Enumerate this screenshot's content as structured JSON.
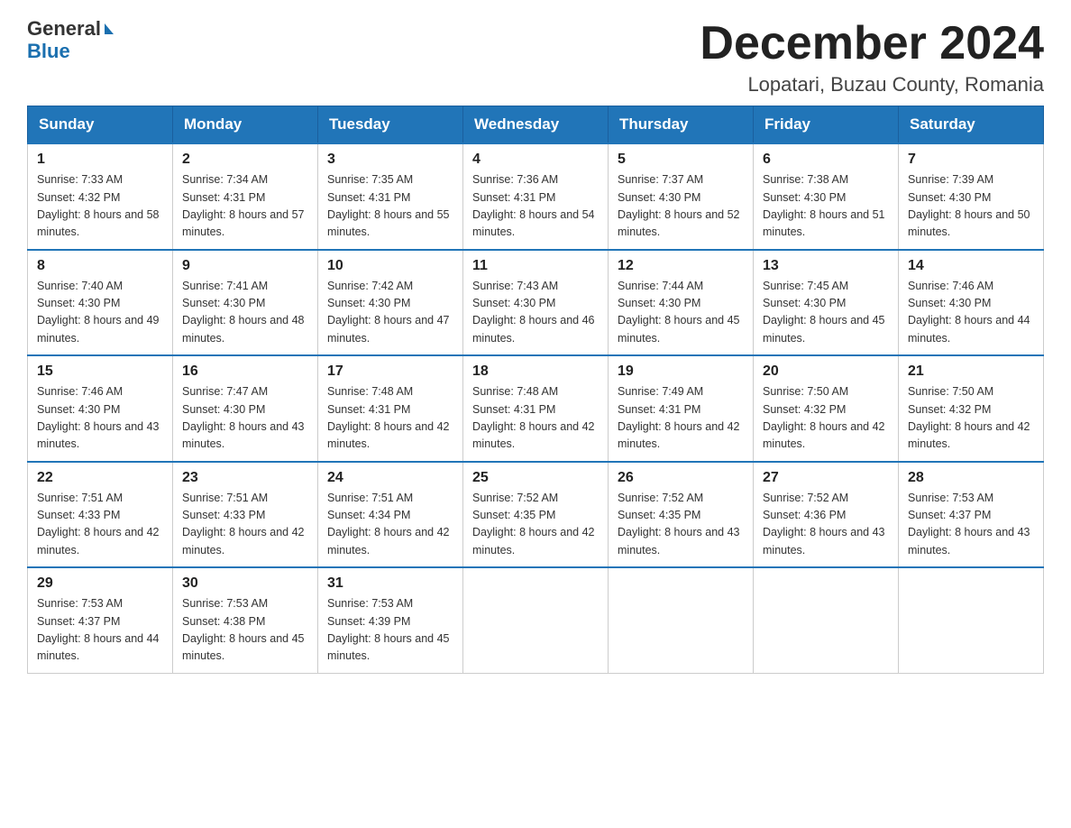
{
  "header": {
    "logo_general": "General",
    "logo_blue": "Blue",
    "month_title": "December 2024",
    "location": "Lopatari, Buzau County, Romania"
  },
  "days_of_week": [
    "Sunday",
    "Monday",
    "Tuesday",
    "Wednesday",
    "Thursday",
    "Friday",
    "Saturday"
  ],
  "weeks": [
    [
      {
        "num": "1",
        "sunrise": "7:33 AM",
        "sunset": "4:32 PM",
        "daylight": "8 hours and 58 minutes."
      },
      {
        "num": "2",
        "sunrise": "7:34 AM",
        "sunset": "4:31 PM",
        "daylight": "8 hours and 57 minutes."
      },
      {
        "num": "3",
        "sunrise": "7:35 AM",
        "sunset": "4:31 PM",
        "daylight": "8 hours and 55 minutes."
      },
      {
        "num": "4",
        "sunrise": "7:36 AM",
        "sunset": "4:31 PM",
        "daylight": "8 hours and 54 minutes."
      },
      {
        "num": "5",
        "sunrise": "7:37 AM",
        "sunset": "4:30 PM",
        "daylight": "8 hours and 52 minutes."
      },
      {
        "num": "6",
        "sunrise": "7:38 AM",
        "sunset": "4:30 PM",
        "daylight": "8 hours and 51 minutes."
      },
      {
        "num": "7",
        "sunrise": "7:39 AM",
        "sunset": "4:30 PM",
        "daylight": "8 hours and 50 minutes."
      }
    ],
    [
      {
        "num": "8",
        "sunrise": "7:40 AM",
        "sunset": "4:30 PM",
        "daylight": "8 hours and 49 minutes."
      },
      {
        "num": "9",
        "sunrise": "7:41 AM",
        "sunset": "4:30 PM",
        "daylight": "8 hours and 48 minutes."
      },
      {
        "num": "10",
        "sunrise": "7:42 AM",
        "sunset": "4:30 PM",
        "daylight": "8 hours and 47 minutes."
      },
      {
        "num": "11",
        "sunrise": "7:43 AM",
        "sunset": "4:30 PM",
        "daylight": "8 hours and 46 minutes."
      },
      {
        "num": "12",
        "sunrise": "7:44 AM",
        "sunset": "4:30 PM",
        "daylight": "8 hours and 45 minutes."
      },
      {
        "num": "13",
        "sunrise": "7:45 AM",
        "sunset": "4:30 PM",
        "daylight": "8 hours and 45 minutes."
      },
      {
        "num": "14",
        "sunrise": "7:46 AM",
        "sunset": "4:30 PM",
        "daylight": "8 hours and 44 minutes."
      }
    ],
    [
      {
        "num": "15",
        "sunrise": "7:46 AM",
        "sunset": "4:30 PM",
        "daylight": "8 hours and 43 minutes."
      },
      {
        "num": "16",
        "sunrise": "7:47 AM",
        "sunset": "4:30 PM",
        "daylight": "8 hours and 43 minutes."
      },
      {
        "num": "17",
        "sunrise": "7:48 AM",
        "sunset": "4:31 PM",
        "daylight": "8 hours and 42 minutes."
      },
      {
        "num": "18",
        "sunrise": "7:48 AM",
        "sunset": "4:31 PM",
        "daylight": "8 hours and 42 minutes."
      },
      {
        "num": "19",
        "sunrise": "7:49 AM",
        "sunset": "4:31 PM",
        "daylight": "8 hours and 42 minutes."
      },
      {
        "num": "20",
        "sunrise": "7:50 AM",
        "sunset": "4:32 PM",
        "daylight": "8 hours and 42 minutes."
      },
      {
        "num": "21",
        "sunrise": "7:50 AM",
        "sunset": "4:32 PM",
        "daylight": "8 hours and 42 minutes."
      }
    ],
    [
      {
        "num": "22",
        "sunrise": "7:51 AM",
        "sunset": "4:33 PM",
        "daylight": "8 hours and 42 minutes."
      },
      {
        "num": "23",
        "sunrise": "7:51 AM",
        "sunset": "4:33 PM",
        "daylight": "8 hours and 42 minutes."
      },
      {
        "num": "24",
        "sunrise": "7:51 AM",
        "sunset": "4:34 PM",
        "daylight": "8 hours and 42 minutes."
      },
      {
        "num": "25",
        "sunrise": "7:52 AM",
        "sunset": "4:35 PM",
        "daylight": "8 hours and 42 minutes."
      },
      {
        "num": "26",
        "sunrise": "7:52 AM",
        "sunset": "4:35 PM",
        "daylight": "8 hours and 43 minutes."
      },
      {
        "num": "27",
        "sunrise": "7:52 AM",
        "sunset": "4:36 PM",
        "daylight": "8 hours and 43 minutes."
      },
      {
        "num": "28",
        "sunrise": "7:53 AM",
        "sunset": "4:37 PM",
        "daylight": "8 hours and 43 minutes."
      }
    ],
    [
      {
        "num": "29",
        "sunrise": "7:53 AM",
        "sunset": "4:37 PM",
        "daylight": "8 hours and 44 minutes."
      },
      {
        "num": "30",
        "sunrise": "7:53 AM",
        "sunset": "4:38 PM",
        "daylight": "8 hours and 45 minutes."
      },
      {
        "num": "31",
        "sunrise": "7:53 AM",
        "sunset": "4:39 PM",
        "daylight": "8 hours and 45 minutes."
      },
      null,
      null,
      null,
      null
    ]
  ]
}
